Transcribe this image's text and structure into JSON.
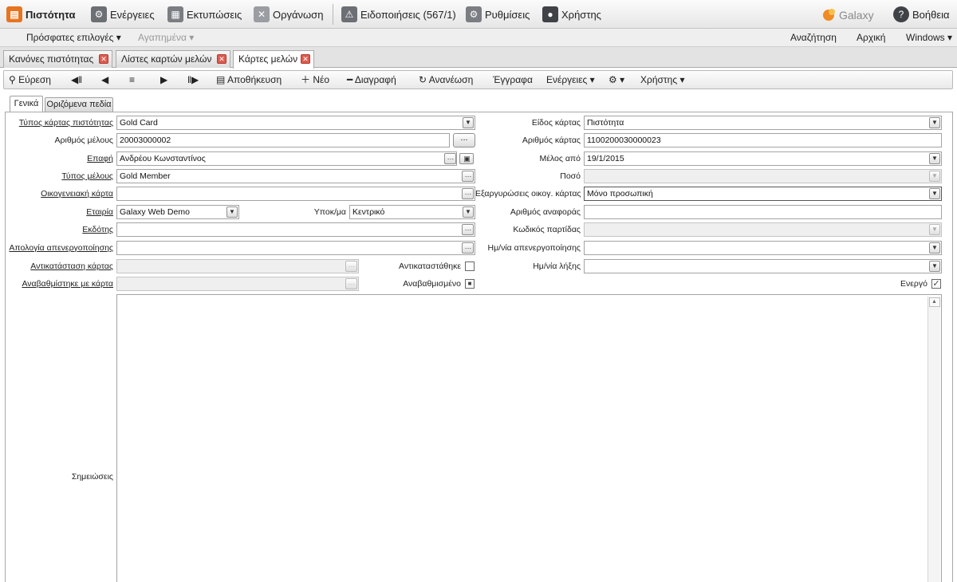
{
  "menubar": {
    "loyalty": "Πιστότητα",
    "actions": "Ενέργειες",
    "prints": "Εκτυπώσεις",
    "organize": "Οργάνωση",
    "notifications": "Ειδοποιήσεις (567/1)",
    "settings": "Ρυθμίσεις",
    "user": "Χρήστης",
    "help": "Βοήθεια",
    "logo_text": "Galaxy"
  },
  "subbar": {
    "recent": "Πρόσφατες επιλογές",
    "favorites": "Αγαπημένα",
    "search": "Αναζήτηση",
    "home": "Αρχική",
    "windows": "Windows"
  },
  "doc_tabs": [
    "Κανόνες πιστότητας",
    "Λίστες καρτών μελών",
    "Κάρτες μελών"
  ],
  "toolbar": {
    "find": "Εύρεση",
    "save": "Αποθήκευση",
    "new": "Νέο",
    "delete": "Διαγραφή",
    "refresh": "Ανανέωση",
    "documents": "Έγγραφα",
    "actions": "Ενέργειες",
    "user": "Χρήστης"
  },
  "form_tabs": [
    "Γενικά",
    "Οριζόμενα πεδία"
  ],
  "form": {
    "card_type_label": "Τύπος κάρτας πιστότητας",
    "card_type_value": "Gold Card",
    "member_number_label": "Αριθμός μέλους",
    "member_number_value": "20003000002",
    "member_number_button": "...",
    "contact_label": "Επαφή",
    "contact_value": "Ανδρέου Κωνσταντίνος",
    "member_type_label": "Τύπος μέλους",
    "member_type_value": "Gold Member",
    "family_card_label": "Οικογενειακή κάρτα",
    "family_card_value": "",
    "company_label": "Εταιρία",
    "company_value": "Galaxy Web Demo",
    "branch_label": "Υποκ/μα",
    "branch_value": "Κεντρικό",
    "issuer_label": "Εκδότης",
    "issuer_value": "",
    "deactivation_reason_label": "Απολογία απενεργοποίησης",
    "deactivation_reason_value": "",
    "card_replacement_label": "Αντικατάσταση κάρτας",
    "replaced_label": "Αντικαταστάθηκε",
    "upgraded_with_label": "Αναβαθμίστηκε με κάρτα",
    "upgraded_label": "Αναβαθμισμένο",
    "card_kind_label": "Είδος κάρτας",
    "card_kind_value": "Πιστότητα",
    "card_number_label": "Αριθμός κάρτας",
    "card_number_value": "1100200030000023",
    "member_since_label": "Μέλος από",
    "member_since_value": "19/1/2015",
    "amount_label": "Ποσό",
    "family_redemptions_label": "Εξαργυρώσεις οικογ. κάρτας",
    "family_redemptions_value": "Μόνο προσωπική",
    "reference_number_label": "Αριθμός αναφοράς",
    "batch_code_label": "Κωδικός παρτίδας",
    "deactivation_date_label": "Ημ/νία απενεργοποίησης",
    "expiry_date_label": "Ημ/νία λήξης",
    "active_label": "Ενεργό",
    "notes_label": "Σημειώσεις"
  }
}
